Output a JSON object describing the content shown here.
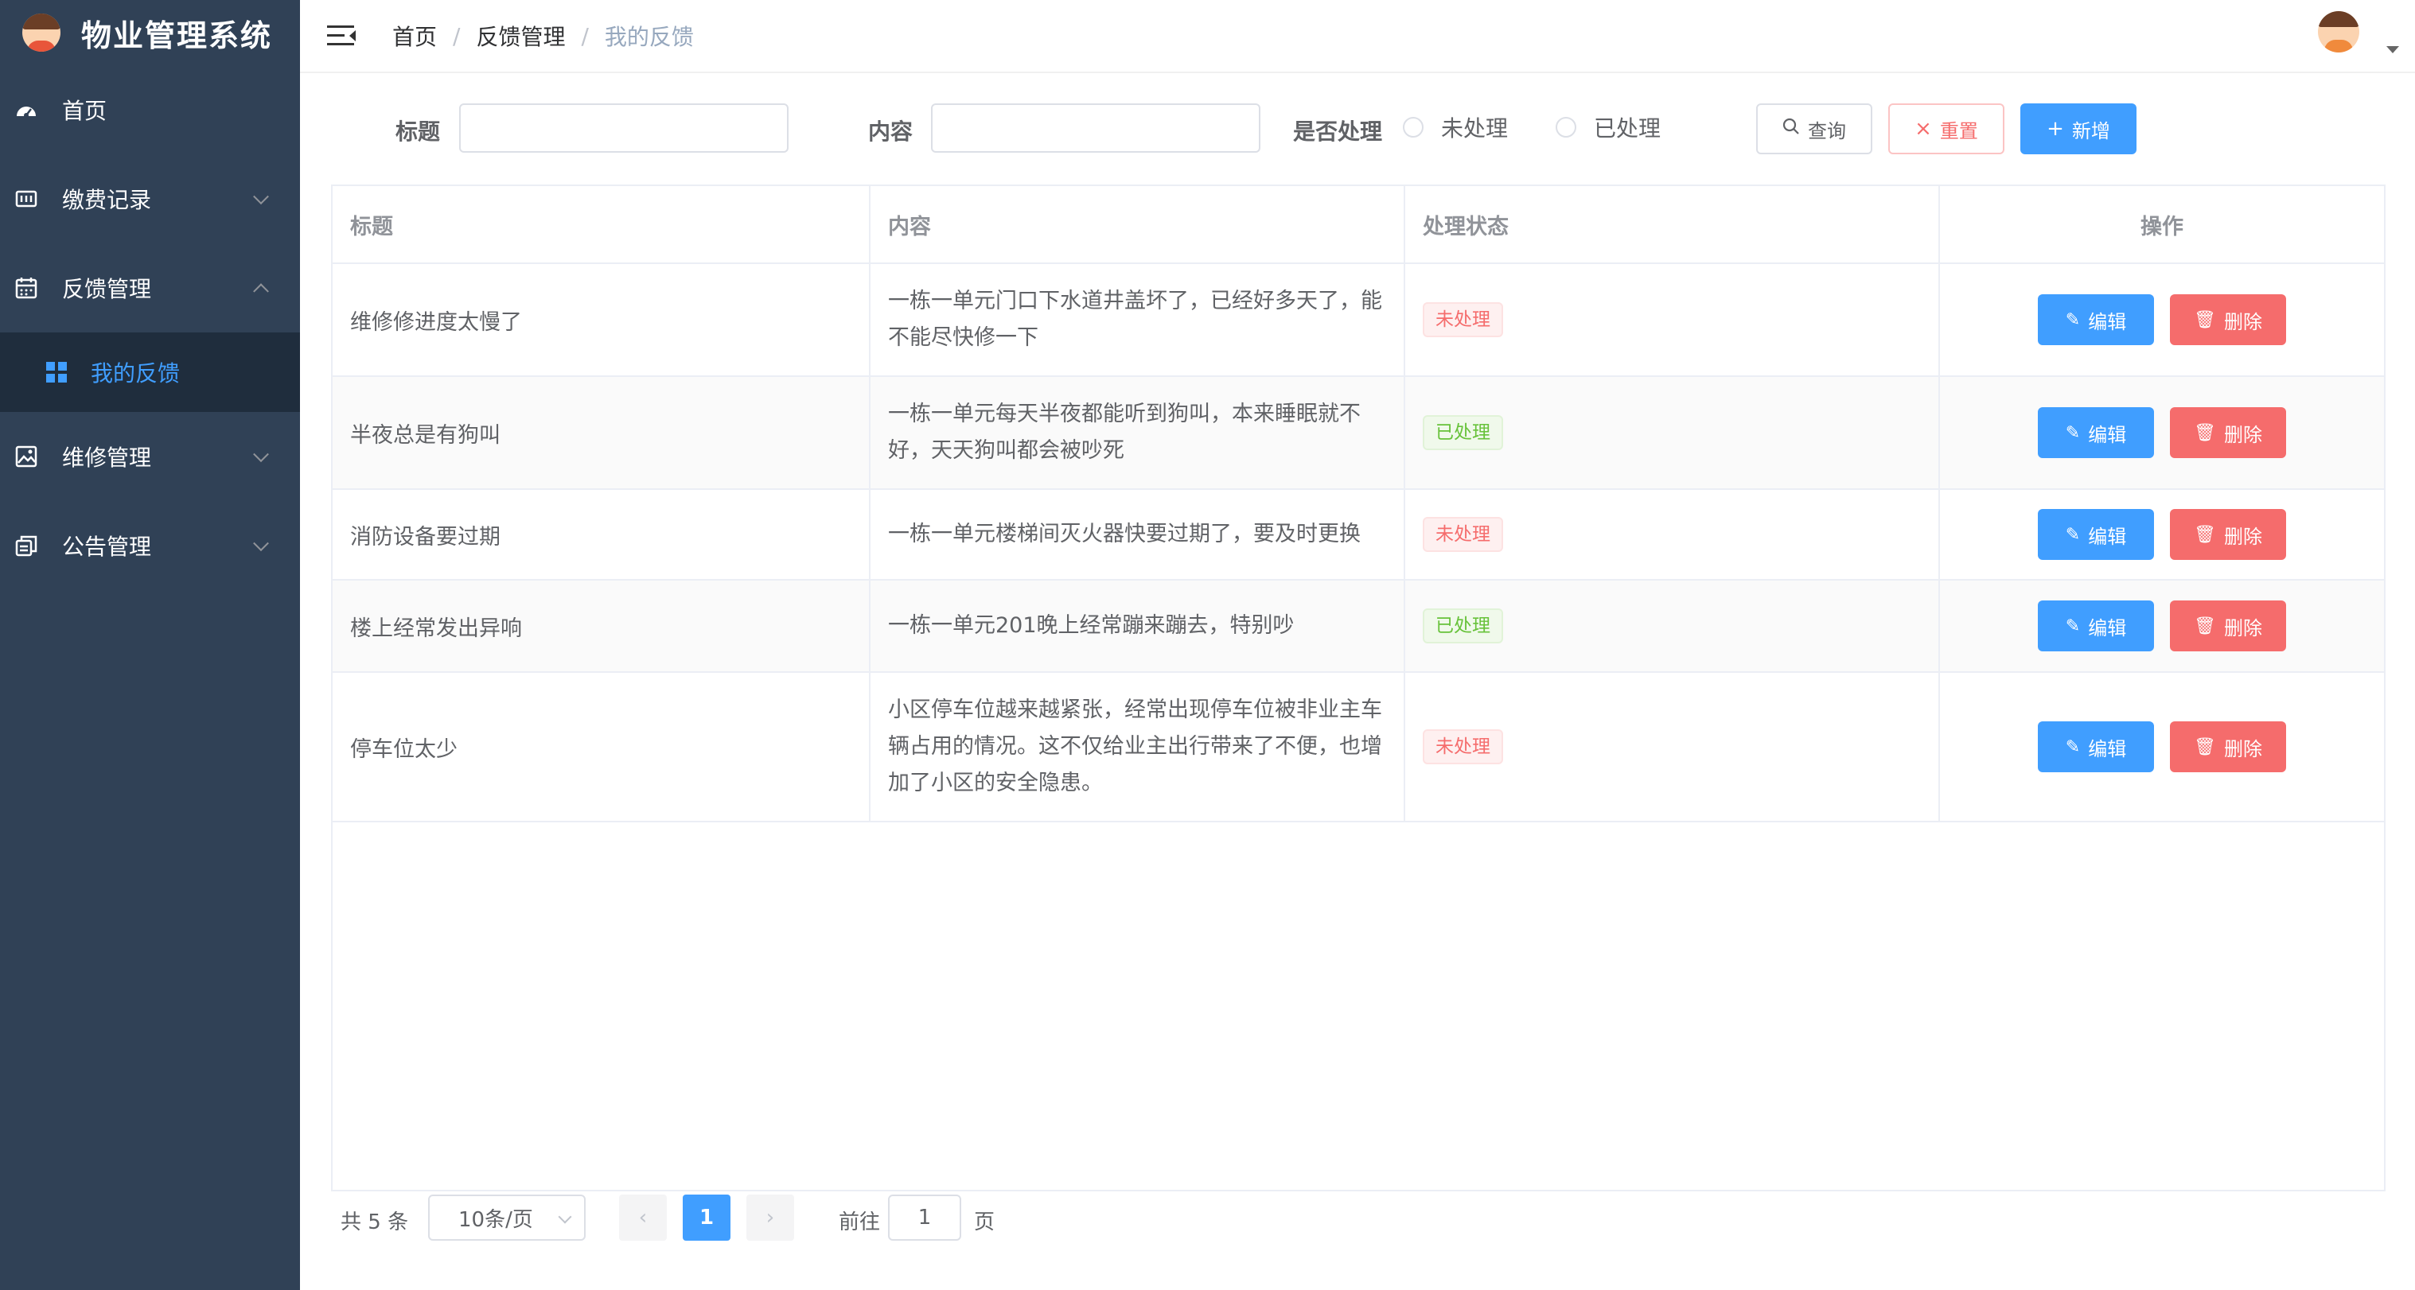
{
  "app": {
    "title": "物业管理系统"
  },
  "sidebar": {
    "items": [
      {
        "label": "首页",
        "icon": "dashboard-icon"
      },
      {
        "label": "缴费记录",
        "icon": "bill-icon"
      },
      {
        "label": "反馈管理",
        "icon": "calendar-icon",
        "children": [
          {
            "label": "我的反馈",
            "icon": "grid-icon",
            "active": true
          }
        ]
      },
      {
        "label": "维修管理",
        "icon": "picture-icon"
      },
      {
        "label": "公告管理",
        "icon": "document-copy-icon"
      }
    ]
  },
  "header": {
    "breadcrumb": [
      "首页",
      "反馈管理",
      "我的反馈"
    ]
  },
  "filter": {
    "title_label": "标题",
    "content_label": "内容",
    "status_label": "是否处理",
    "options": [
      "未处理",
      "已处理"
    ],
    "query_label": "查询",
    "reset_label": "重置",
    "add_label": "新增"
  },
  "table": {
    "columns": [
      "标题",
      "内容",
      "处理状态",
      "操作"
    ],
    "edit_label": "编辑",
    "delete_label": "删除",
    "rows": [
      {
        "title": "维修修进度太慢了",
        "content": "一栋一单元门口下水道井盖坏了，已经好多天了，能不能尽快修一下",
        "status": "未处理"
      },
      {
        "title": "半夜总是有狗叫",
        "content": "一栋一单元每天半夜都能听到狗叫，本来睡眠就不好，天天狗叫都会被吵死",
        "status": "已处理"
      },
      {
        "title": "消防设备要过期",
        "content": "一栋一单元楼梯间灭火器快要过期了，要及时更换",
        "status": "未处理"
      },
      {
        "title": "楼上经常发出异响",
        "content": "一栋一单元201晚上经常蹦来蹦去，特别吵",
        "status": "已处理"
      },
      {
        "title": "停车位太少",
        "content": "小区停车位越来越紧张，经常出现停车位被非业主车辆占用的情况。这不仅给业主出行带来了不便，也增加了小区的安全隐患。",
        "status": "未处理"
      }
    ]
  },
  "pagination": {
    "total_text": "共 5 条",
    "page_size": "10条/页",
    "current_page": "1",
    "goto_label": "前往",
    "goto_value": "1",
    "page_suffix": "页"
  },
  "colors": {
    "primary": "#409eff",
    "danger": "#f56c6c",
    "success": "#67c23a",
    "sidebar_bg": "#304156",
    "sidebar_active_bg": "#1f2d3d"
  }
}
